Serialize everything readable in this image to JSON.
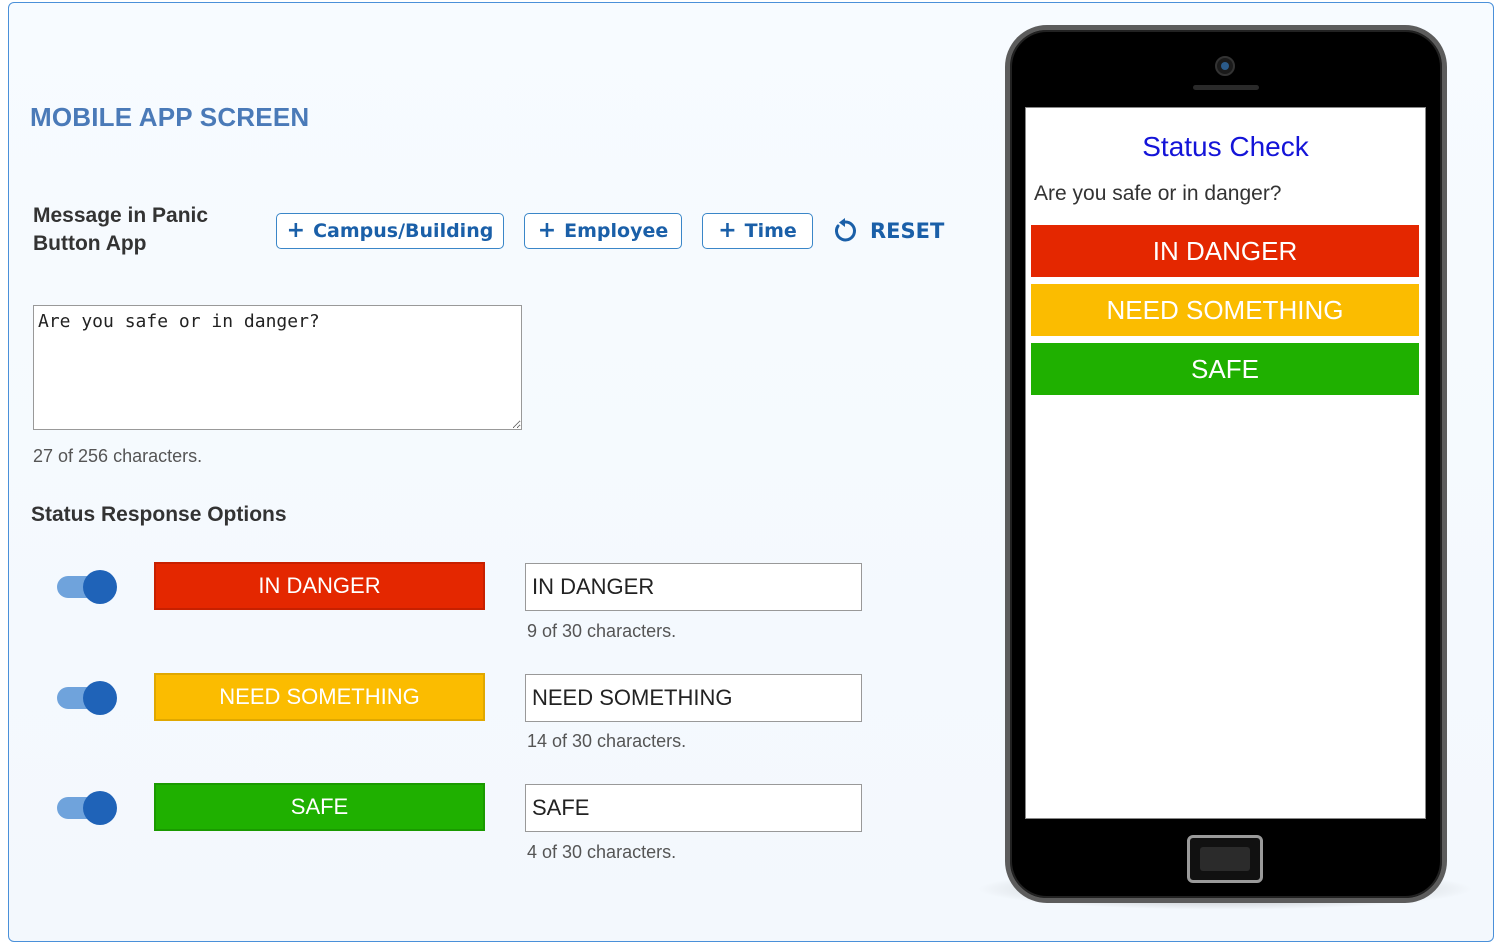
{
  "section_title": "MOBILE APP SCREEN",
  "message_label": "Message in Panic Button App",
  "insert_buttons": [
    {
      "label": "Campus/Building"
    },
    {
      "label": "Employee"
    },
    {
      "label": "Time"
    }
  ],
  "reset_label": "RESET",
  "message": {
    "value": "Are you safe or in danger?",
    "char_count": "27 of 256 characters."
  },
  "options_title": "Status Response Options",
  "options": [
    {
      "enabled": true,
      "swatch_label": "IN DANGER",
      "color": "#e42700",
      "input_value": "IN DANGER",
      "char_count": "9 of 30 characters."
    },
    {
      "enabled": true,
      "swatch_label": "NEED SOMETHING",
      "color": "#fbbc00",
      "input_value": "NEED SOMETHING",
      "char_count": "14 of 30 characters."
    },
    {
      "enabled": true,
      "swatch_label": "SAFE",
      "color": "#1fb000",
      "input_value": "SAFE",
      "char_count": "4 of 30 characters."
    }
  ],
  "phone": {
    "title": "Status Check",
    "question": "Are you safe or in danger?",
    "buttons": [
      {
        "label": "IN DANGER",
        "color": "#e42700"
      },
      {
        "label": "NEED SOMETHING",
        "color": "#fbbc00"
      },
      {
        "label": "SAFE",
        "color": "#1fb000"
      }
    ]
  },
  "icons": {
    "plus": "plus-icon",
    "reset": "reset-icon"
  }
}
